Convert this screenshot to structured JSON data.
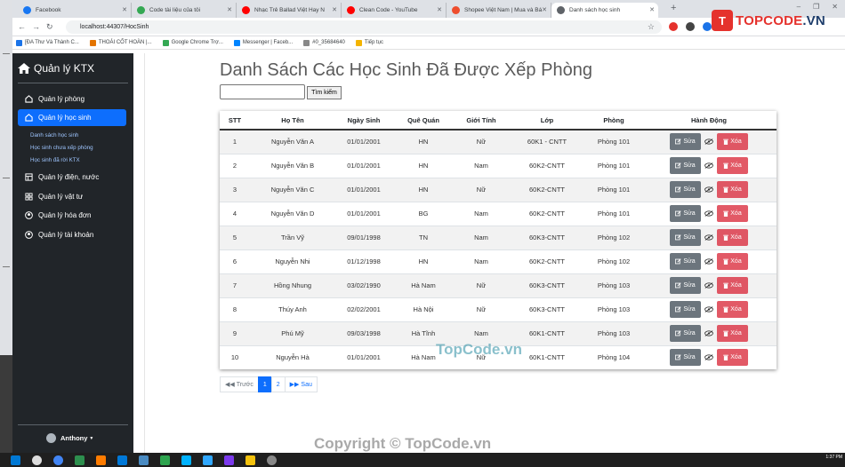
{
  "browser": {
    "tabs": [
      {
        "label": "Facebook",
        "color": "#1877f2"
      },
      {
        "label": "Code tài liệu của tôi",
        "color": "#34a853"
      },
      {
        "label": "Nhạc Trẻ Ballad Việt Hay N",
        "color": "#ff0000"
      },
      {
        "label": "Clean Code - YouTube",
        "color": "#ff0000"
      },
      {
        "label": "Shopee Việt Nam | Mua và Bá",
        "color": "#ee4d2d"
      },
      {
        "label": "Danh sách học sinh",
        "color": "#5f6368"
      }
    ],
    "new_tab": "+",
    "url": "localhost:44307/HocSinh",
    "bookmarks": [
      "[ĐA Thư Và Thành C...",
      "THOÁI CỐT HOÀN |...",
      "Google Chrome Trợ...",
      "Messenger | Faceb...",
      "#0_35684640",
      "Tiếp tục"
    ]
  },
  "logo": {
    "mark": "T",
    "text_a": "TOPCODE",
    "text_b": ".VN"
  },
  "sidebar": {
    "brand": "Quản lý KTX",
    "items": [
      {
        "label": "Quản lý phòng",
        "icon": "home-icon"
      },
      {
        "label": "Quản lý học sinh",
        "icon": "home-icon",
        "active": true
      },
      {
        "label": "Quản lý điện, nước",
        "icon": "table-icon"
      },
      {
        "label": "Quản lý vật tư",
        "icon": "grid-icon"
      },
      {
        "label": "Quản lý hóa đơn",
        "icon": "user-circle-icon"
      },
      {
        "label": "Quản lý tài khoản",
        "icon": "user-circle-icon"
      }
    ],
    "subitems": [
      "Danh sách học sinh",
      "Học sinh chưa xếp phòng",
      "Học sinh đã rời KTX"
    ],
    "user": "Anthony"
  },
  "main": {
    "title": "Danh Sách Các Học Sinh Đã Được Xếp Phòng",
    "search_button": "Tìm kiếm",
    "table": {
      "headers": [
        "STT",
        "Họ Tên",
        "Ngày Sinh",
        "Quê Quán",
        "Giới Tính",
        "Lớp",
        "Phòng",
        "Hành Động"
      ],
      "rows": [
        [
          "1",
          "Nguyễn Văn A",
          "01/01/2001",
          "HN",
          "Nữ",
          "60K1 - CNTT",
          "Phòng 101"
        ],
        [
          "2",
          "Nguyễn Văn B",
          "01/01/2001",
          "HN",
          "Nam",
          "60K2-CNTT",
          "Phòng 101"
        ],
        [
          "3",
          "Nguyễn Văn C",
          "01/01/2001",
          "HN",
          "Nữ",
          "60K2-CNTT",
          "Phòng 101"
        ],
        [
          "4",
          "Nguyễn Văn D",
          "01/01/2001",
          "BG",
          "Nam",
          "60K2-CNTT",
          "Phòng 101"
        ],
        [
          "5",
          "Trần Vỹ",
          "09/01/1998",
          "TN",
          "Nam",
          "60K3-CNTT",
          "Phòng 102"
        ],
        [
          "6",
          "Nguyễn Nhi",
          "01/12/1998",
          "HN",
          "Nam",
          "60K2-CNTT",
          "Phòng 102"
        ],
        [
          "7",
          "Hồng Nhung",
          "03/02/1990",
          "Hà Nam",
          "Nữ",
          "60K3-CNTT",
          "Phòng 103"
        ],
        [
          "8",
          "Thúy Anh",
          "02/02/2001",
          "Hà Nội",
          "Nữ",
          "60K3-CNTT",
          "Phòng 103"
        ],
        [
          "9",
          "Phú Mỹ",
          "09/03/1998",
          "Hà Tĩnh",
          "Nam",
          "60K1-CNTT",
          "Phòng 103"
        ],
        [
          "10",
          "Nguyễn Hà",
          "01/01/2001",
          "Hà Nam",
          "Nữ",
          "60K1-CNTT",
          "Phòng 104"
        ]
      ],
      "edit_label": "Sửa",
      "delete_label": "Xóa"
    },
    "pagination": {
      "prev": "Trước",
      "pages": [
        "1",
        "2"
      ],
      "current": "1",
      "next": "Sau"
    }
  },
  "watermarks": {
    "middle": "TopCode.vn",
    "bottom": "Copyright © TopCode.vn"
  },
  "taskbar": {
    "time": "1:37 PM"
  },
  "colors": {
    "sidebar_bg": "#212529",
    "primary": "#0d6efd",
    "edit": "#6c757d",
    "delete": "#dc3545"
  }
}
